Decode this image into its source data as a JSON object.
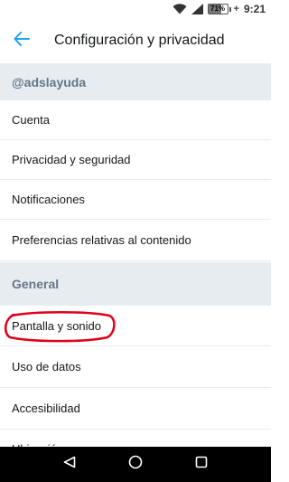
{
  "status_bar": {
    "battery_percent": "71%",
    "time": "9:21"
  },
  "header": {
    "title": "Configuración y privacidad"
  },
  "account_section": {
    "label": "@adslayuda",
    "items": [
      "Cuenta",
      "Privacidad y seguridad",
      "Notificaciones",
      "Preferencias relativas al contenido"
    ]
  },
  "general_section": {
    "label": "General",
    "items": [
      "Pantalla y sonido",
      "Uso de datos",
      "Accesibilidad",
      "Ubicación"
    ]
  },
  "colors": {
    "accent": "#1da1f2",
    "section_bg": "#e6ecf0",
    "section_text": "#657786",
    "highlight": "#e0001a"
  },
  "icons": {
    "back": "arrow-left-icon",
    "nav_back": "triangle-back-icon",
    "nav_home": "circle-home-icon",
    "nav_recents": "square-recents-icon"
  }
}
